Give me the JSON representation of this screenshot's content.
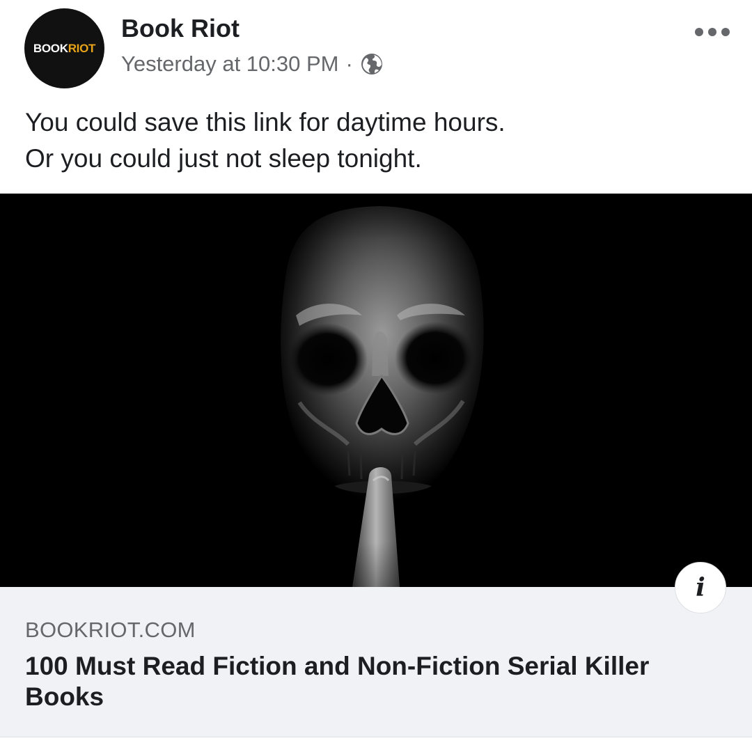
{
  "post": {
    "author": "Book Riot",
    "avatar_logo": {
      "part1": "BOOK",
      "part2": "RIOT"
    },
    "timestamp": "Yesterday at 10:30 PM",
    "separator": "·",
    "audience_icon": "globe-icon",
    "more_icon": "more-options-icon",
    "text_lines": [
      "You could save this link for daytime hours.",
      "Or you could just not sleep tonight."
    ]
  },
  "link_preview": {
    "info_icon": "info-icon",
    "info_glyph": "i",
    "domain": "BOOKRIOT.COM",
    "title": "100 Must Read Fiction and Non-Fiction Serial Killer Books"
  },
  "colors": {
    "text_primary": "#1c1e21",
    "text_secondary": "#65676b",
    "card_background": "#f0f2f5",
    "logo_accent": "#e8a319"
  }
}
